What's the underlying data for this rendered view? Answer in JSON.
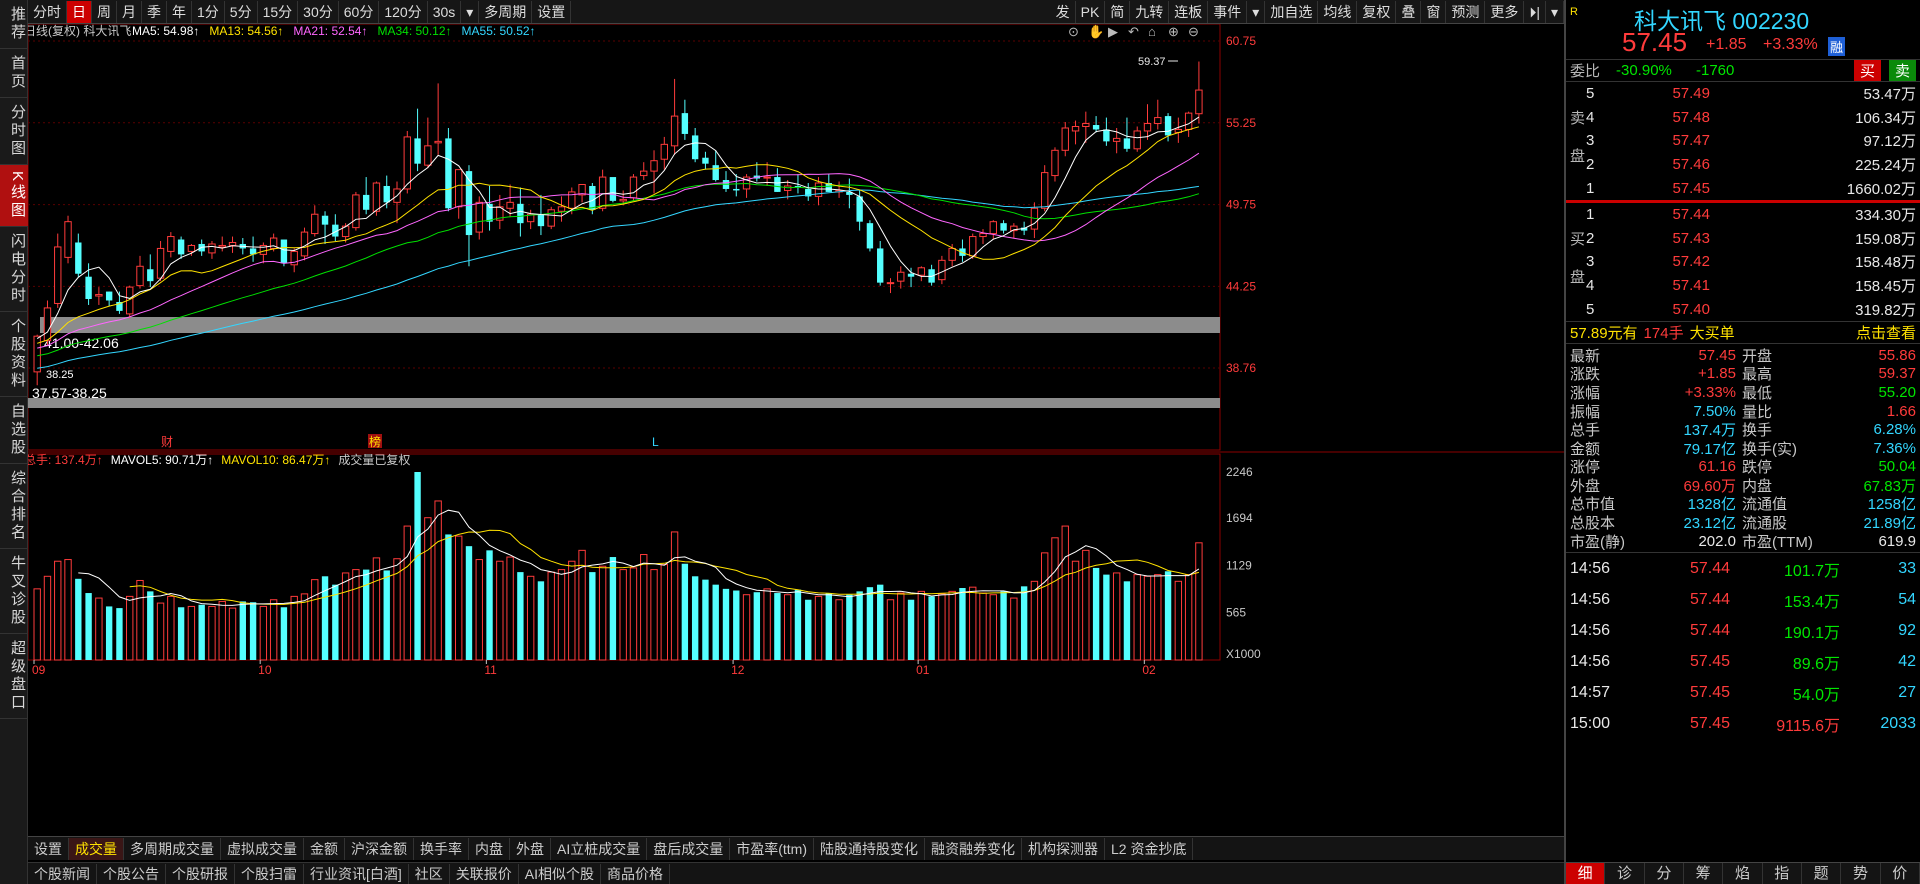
{
  "left_tabs": [
    "推荐",
    "首页",
    "分时图",
    "K线图",
    "闪电分时",
    "个股资料",
    "自选股",
    "综合排名",
    "牛叉诊股",
    "超级盘口"
  ],
  "toolbar": {
    "left": [
      "分时",
      "日",
      "周",
      "月",
      "季",
      "年",
      "1分",
      "5分",
      "15分",
      "30分",
      "60分",
      "120分",
      "30s",
      "▾",
      "多周期",
      "设置"
    ],
    "right": [
      "发",
      "PK",
      "简",
      "九转",
      "连板",
      "事件",
      "▾",
      "加自选",
      "均线",
      "复权",
      "叠",
      "窗",
      "预测",
      "更多",
      "⏵|",
      "▾"
    ]
  },
  "chart": {
    "legend_prefix": "日线(复权)  科大讯飞",
    "ma_labels": [
      {
        "t": "MA5: 54.98↑",
        "c": "#ffffff"
      },
      {
        "t": "MA13: 54.56↑",
        "c": "#ffe200"
      },
      {
        "t": "MA21: 52.54↑",
        "c": "#ff66ff"
      },
      {
        "t": "MA34: 50.12↑",
        "c": "#00e000"
      },
      {
        "t": "MA55: 50.52↑",
        "c": "#33d6ff"
      }
    ],
    "y_ticks": [
      "60.75",
      "55.25",
      "49.75",
      "44.25",
      "38.76"
    ],
    "zone_labels": [
      "41.00-42.06",
      "37.57-38.25",
      "38.25"
    ],
    "high_label": "59.37",
    "markers": [
      "财",
      "榜",
      "L"
    ],
    "vol_legend": [
      {
        "t": "总手: 137.4万↑",
        "c": "#ff3b3b"
      },
      {
        "t": "MAVOL5: 90.71万↑",
        "c": "#ffffff"
      },
      {
        "t": "MAVOL10: 86.47万↑",
        "c": "#ffe200"
      },
      {
        "t": "成交量已复权",
        "c": "#c8c8c8"
      }
    ],
    "vol_ticks": [
      "2246",
      "1694",
      "1129",
      "565"
    ],
    "vol_unit": "X1000",
    "months": [
      "09",
      "10",
      "11",
      "12",
      "01",
      "02"
    ]
  },
  "bottom_tabs": [
    "设置",
    "成交量",
    "多周期成交量",
    "虚拟成交量",
    "金额",
    "沪深金额",
    "换手率",
    "内盘",
    "外盘",
    "AI立桩成交量",
    "盘后成交量",
    "市盈率(ttm)",
    "陆股通持股变化",
    "融资融券变化",
    "机构探测器",
    "L2 资金抄底"
  ],
  "news_tabs": [
    "个股新闻",
    "个股公告",
    "个股研报",
    "个股扫雷",
    "行业资讯[白酒]",
    "社区",
    "关联报价",
    "AI相似个股",
    "商品价格"
  ],
  "right": {
    "name": "科大讯飞",
    "code": "002230",
    "price": "57.45",
    "chg": "+1.85",
    "pct": "+3.33%",
    "tag": "融",
    "weibi_label": "委比",
    "weibi": "-30.90%",
    "weicha": "-1760",
    "buy_btn": "买",
    "sell_btn": "卖",
    "sell_side": "卖盘",
    "buy_side": "买盘",
    "asks": [
      {
        "n": "5",
        "p": "57.49",
        "v": "53.47万"
      },
      {
        "n": "4",
        "p": "57.48",
        "v": "106.34万"
      },
      {
        "n": "3",
        "p": "57.47",
        "v": "97.12万"
      },
      {
        "n": "2",
        "p": "57.46",
        "v": "225.24万"
      },
      {
        "n": "1",
        "p": "57.45",
        "v": "1660.02万"
      }
    ],
    "bids": [
      {
        "n": "1",
        "p": "57.44",
        "v": "334.30万"
      },
      {
        "n": "2",
        "p": "57.43",
        "v": "159.08万"
      },
      {
        "n": "3",
        "p": "57.42",
        "v": "158.48万"
      },
      {
        "n": "4",
        "p": "57.41",
        "v": "158.45万"
      },
      {
        "n": "5",
        "p": "57.40",
        "v": "319.82万"
      }
    ],
    "big_order": {
      "a": "57.89元有",
      "b": "174手",
      "c": "大买单",
      "link": "点击查看"
    },
    "quotes": [
      [
        "最新",
        "57.45",
        "red",
        "开盘",
        "55.86",
        "red"
      ],
      [
        "涨跌",
        "+1.85",
        "red",
        "最高",
        "59.37",
        "red"
      ],
      [
        "涨幅",
        "+3.33%",
        "red",
        "最低",
        "55.20",
        "grn"
      ],
      [
        "振幅",
        "7.50%",
        "cyan",
        "量比",
        "1.66",
        "red"
      ],
      [
        "总手",
        "137.4万",
        "cyan",
        "换手",
        "6.28%",
        "cyan"
      ],
      [
        "金额",
        "79.17亿",
        "cyan",
        "换手(实)",
        "7.36%",
        "cyan"
      ],
      [
        "涨停",
        "61.16",
        "red",
        "跌停",
        "50.04",
        "grn"
      ],
      [
        "外盘",
        "69.60万",
        "red",
        "内盘",
        "67.83万",
        "grn"
      ],
      [
        "总市值",
        "1328亿",
        "cyan",
        "流通值",
        "1258亿",
        "cyan"
      ],
      [
        "总股本",
        "23.12亿",
        "cyan",
        "流通股",
        "21.89亿",
        "cyan"
      ],
      [
        "市盈(静)",
        "202.0",
        "wht",
        "市盈(TTM)",
        "619.9",
        "wht"
      ]
    ],
    "ticks": [
      [
        "14:56",
        "57.44",
        "101.7万",
        "33"
      ],
      [
        "14:56",
        "57.44",
        "153.4万",
        "54"
      ],
      [
        "14:56",
        "57.44",
        "190.1万",
        "92"
      ],
      [
        "14:56",
        "57.45",
        "89.6万",
        "42"
      ],
      [
        "14:57",
        "57.45",
        "54.0万",
        "27"
      ],
      [
        "15:00",
        "57.45",
        "9115.6万",
        "2033"
      ]
    ],
    "footer_tabs": [
      "细",
      "诊",
      "分",
      "筹",
      "焰",
      "指",
      "题",
      "势",
      "价"
    ]
  }
}
